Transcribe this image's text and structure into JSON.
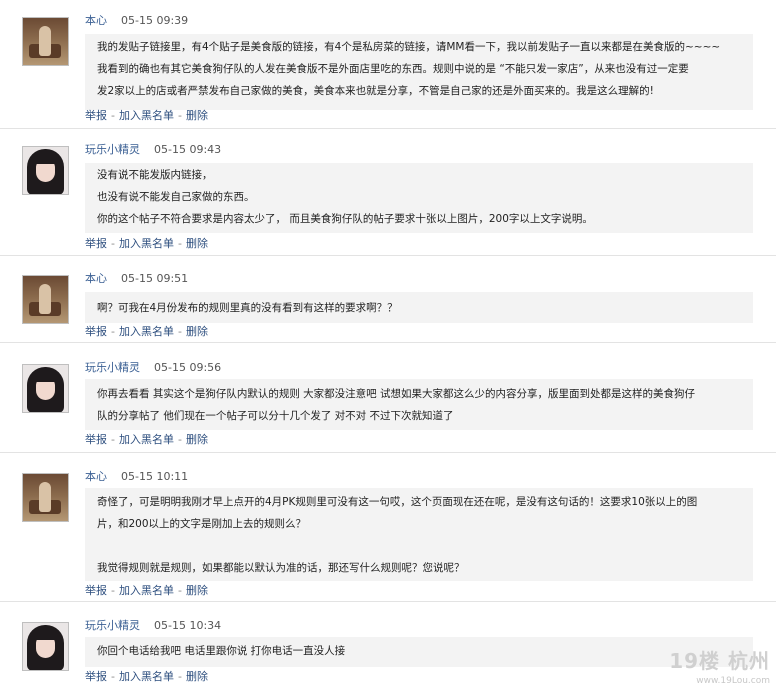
{
  "posts": [
    {
      "author": "本心",
      "time": "05-15  09:39",
      "lines": [
        "我的发贴子链接里，有4个贴子是美食版的链接，有4个是私房菜的链接，请MM看一下，我以前发贴子一直以来都是在美食版的~~~~",
        "我看到的确也有其它美食狗仔队的人发在美食版不是外面店里吃的东西。规则中说的是 “不能只发一家店”，从来也没有过一定要",
        "发2家以上的店或者严禁发布自己家做的美食，美食本来也就是分享，不管是自己家的还是外面买来的。我是这么理解的!"
      ]
    },
    {
      "author": "玩乐小精灵",
      "time": "05-15  09:43",
      "lines": [
        "没有说不能发版内链接，",
        "也没有说不能发自己家做的东西。",
        "你的这个帖子不符合要求是内容太少了， 而且美食狗仔队的帖子要求十张以上图片，200字以上文字说明。"
      ]
    },
    {
      "author": "本心",
      "time": "05-15  09:51",
      "lines": [
        "啊？可我在4月份发布的规则里真的没有看到有这样的要求啊？？"
      ]
    },
    {
      "author": "玩乐小精灵",
      "time": "05-15  09:56",
      "lines": [
        "你再去看看  其实这个是狗仔队内默认的规则  大家都没注意吧  试想如果大家都这么少的内容分享，版里面到处都是这样的美食狗仔",
        "队的分享帖了  他们现在一个帖子可以分十几个发了  对不对  不过下次就知道了"
      ]
    },
    {
      "author": "本心",
      "time": "05-15  10:11",
      "lines": [
        "奇怪了，可是明明我刚才早上点开的4月PK规则里可没有这一句哎，这个页面现在还在呢，是没有这句话的！这要求10张以上的图",
        "片，和200以上的文字是刚加上去的规则么？",
        "",
        "我觉得规则就是规则，如果都能以默认为准的话，那还写什么规则呢？您说呢？"
      ]
    },
    {
      "author": "玩乐小精灵",
      "time": "05-15  10:34",
      "lines": [
        "你回个电话给我吧  电话里跟你说  打你电话一直没人接"
      ]
    }
  ],
  "actions": {
    "report": "举报",
    "blacklist": "加入黑名单",
    "delete": "删除",
    "separator": "-"
  },
  "watermark": {
    "brand": "19楼 杭州",
    "url": "www.19Lou.com"
  }
}
